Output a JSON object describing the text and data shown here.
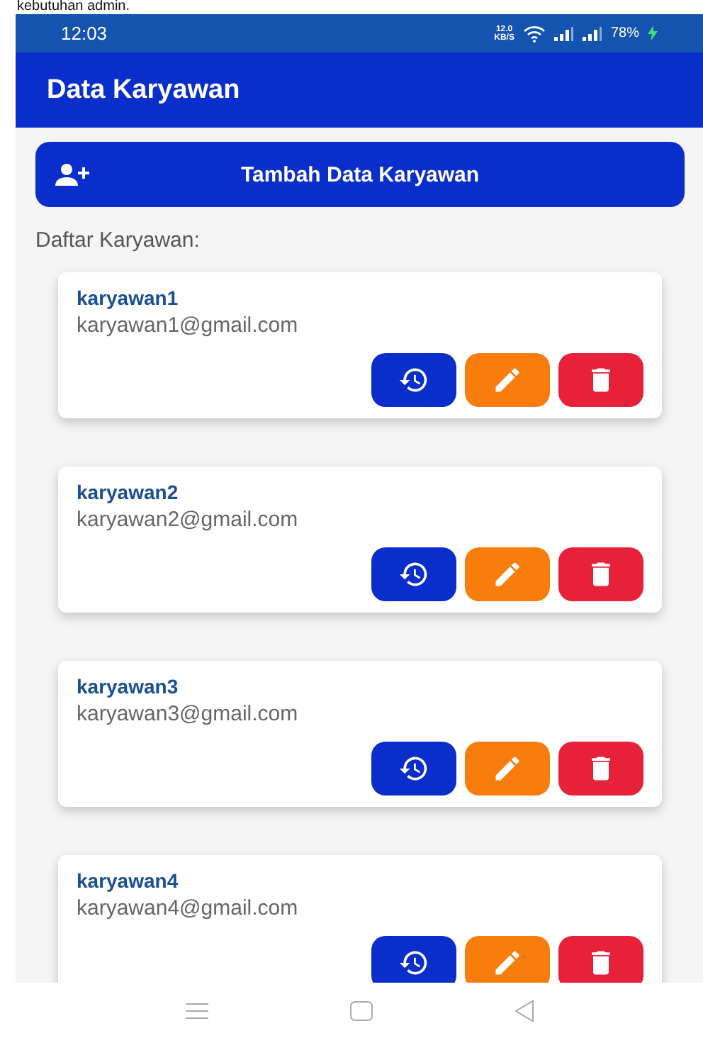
{
  "caption": "kebutuhan admin.",
  "status_bar": {
    "time": "12:03",
    "speed_value": "12.0",
    "speed_unit": "KB/S",
    "battery": "78%",
    "charging": true
  },
  "app_bar": {
    "title": "Data Karyawan"
  },
  "add_button": {
    "label": "Tambah Data Karyawan"
  },
  "list_label": "Daftar Karyawan:",
  "employees": [
    {
      "name": "karyawan1",
      "email": "karyawan1@gmail.com"
    },
    {
      "name": "karyawan2",
      "email": "karyawan2@gmail.com"
    },
    {
      "name": "karyawan3",
      "email": "karyawan3@gmail.com"
    },
    {
      "name": "karyawan4",
      "email": "karyawan4@gmail.com"
    }
  ],
  "actions": [
    {
      "kind": "history"
    },
    {
      "kind": "edit"
    },
    {
      "kind": "delete"
    }
  ]
}
